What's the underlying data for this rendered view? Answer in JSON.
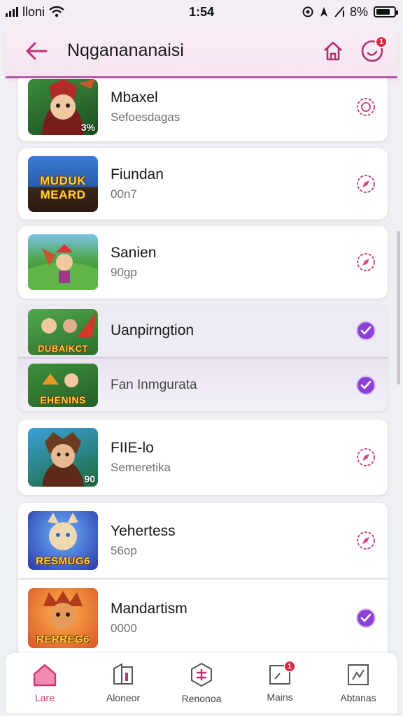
{
  "status_bar": {
    "carrier": "lloni",
    "time": "1:54",
    "battery": "8%"
  },
  "header": {
    "title": "Nqganananaisi",
    "notification_count": "1"
  },
  "items": [
    {
      "title": "Mbaxel",
      "subtitle": "Sefoesdagas",
      "thumb_tag": "3%",
      "thumb_banner": "",
      "selected": false
    },
    {
      "title": "Fiundan",
      "subtitle": "00n7",
      "thumb_tag": "",
      "thumb_banner": "MUDUK MEARD",
      "selected": false
    },
    {
      "title": "Sanien",
      "subtitle": "90gp",
      "thumb_tag": "",
      "thumb_banner": "",
      "selected": false
    },
    {
      "title": "Uanpirngtion",
      "subtitle": "",
      "thumb_tag": "",
      "thumb_banner": "DUBAIKCT",
      "selected": true
    },
    {
      "title": "Fan Inmgurata",
      "subtitle": "",
      "thumb_tag": "",
      "thumb_banner": "EHENINS",
      "selected": true
    },
    {
      "title": "FIIE-lo",
      "subtitle": "Semeretika",
      "thumb_tag": "90",
      "thumb_banner": "",
      "selected": false
    },
    {
      "title": "Yehertess",
      "subtitle": "56op",
      "thumb_tag": "",
      "thumb_banner": "RESMUG6",
      "selected": false
    },
    {
      "title": "Mandartism",
      "subtitle": "0000",
      "thumb_tag": "",
      "thumb_banner": "RERREG6",
      "selected": true
    }
  ],
  "bottom_nav": [
    {
      "label": "Lare",
      "icon": "home-icon",
      "active": true
    },
    {
      "label": "Aloneor",
      "icon": "library-icon",
      "active": false
    },
    {
      "label": "Renonoa",
      "icon": "add-hex-icon",
      "active": false
    },
    {
      "label": "Mains",
      "icon": "inbox-icon",
      "active": false,
      "badge": "1"
    },
    {
      "label": "Abtanas",
      "icon": "activity-icon",
      "active": false
    }
  ],
  "colors": {
    "accent": "#c0307a",
    "check_purple": "#8e3fd6",
    "header_border": "#b457a8",
    "badge": "#e0263a"
  }
}
